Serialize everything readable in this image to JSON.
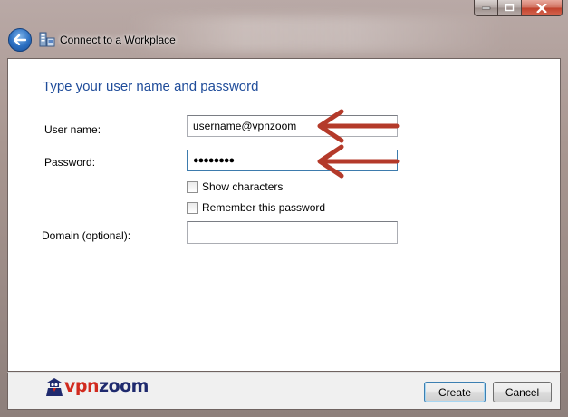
{
  "window": {
    "title": "Connect to a Workplace",
    "caption_buttons": [
      "minimize",
      "maximize",
      "close"
    ]
  },
  "form": {
    "heading": "Type your user name and password",
    "username_label": "User name:",
    "username_value": "username@vpnzoom",
    "password_label": "Password:",
    "password_value": "●●●●●●●●",
    "show_characters_label": "Show characters",
    "show_characters_checked": false,
    "remember_password_label": "Remember this password",
    "remember_password_checked": false,
    "domain_label": "Domain (optional):",
    "domain_value": ""
  },
  "footer": {
    "logo_text_vpn": "vpn",
    "logo_text_zoom": "zoom",
    "create_label": "Create",
    "cancel_label": "Cancel"
  },
  "icons": {
    "back": "back-arrow-icon",
    "title": "network-workplace-icon",
    "annotation": "red-arrow-icon"
  },
  "colors": {
    "heading": "#1f4c9a",
    "annotation_arrow": "#b43a2a",
    "logo_red": "#d12a1e",
    "logo_navy": "#1f2a6e"
  }
}
